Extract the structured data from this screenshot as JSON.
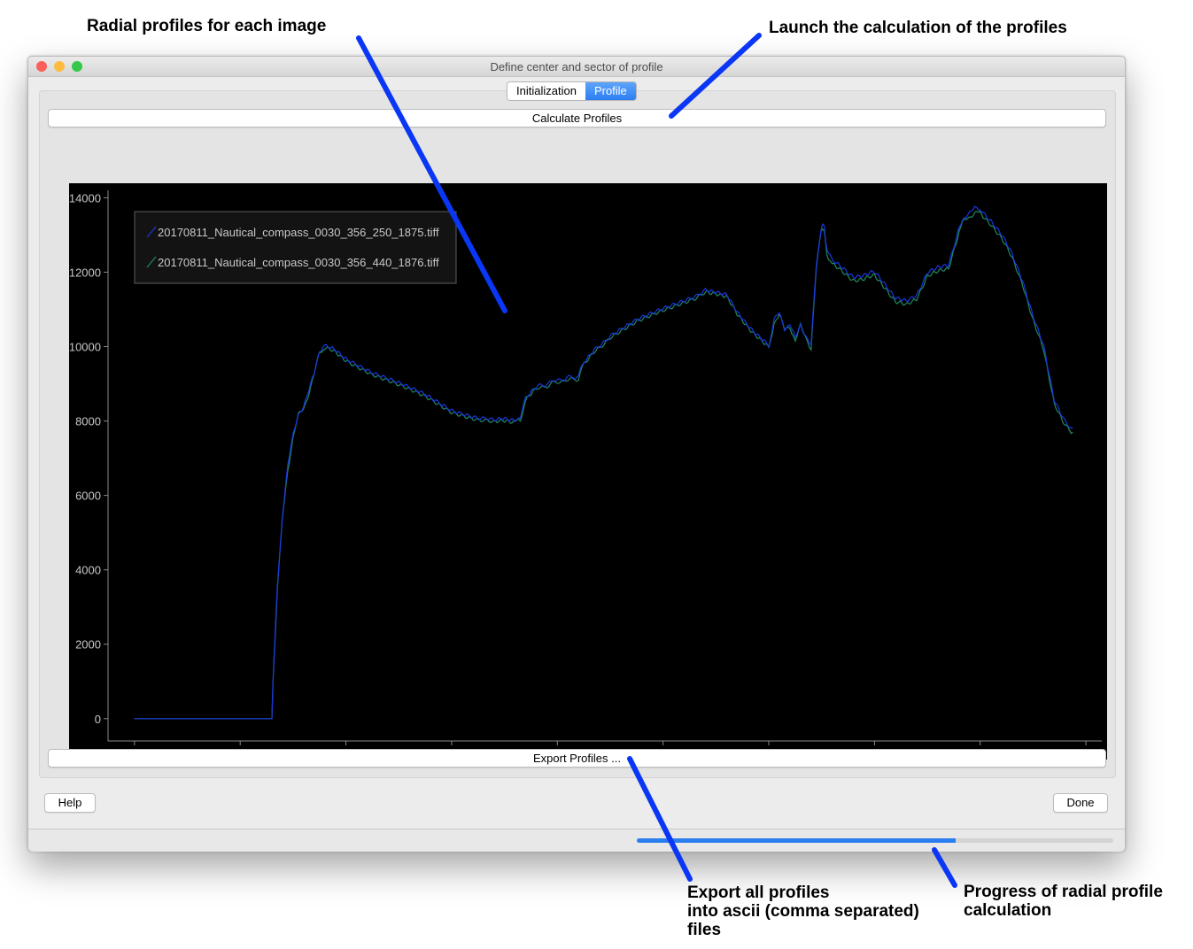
{
  "annotations": {
    "radial": "Radial profiles for each image",
    "launch": "Launch the calculation of the profiles",
    "export_line1": "Export all profiles",
    "export_line2": "into ascii (comma separated)",
    "export_line3": "files",
    "progress_line1": "Progress of radial profile",
    "progress_line2": "calculation",
    "arrow_color": "#0a36f5"
  },
  "window": {
    "title": "Define center and sector of profile",
    "traffic_lights": {
      "close": "#fc605c",
      "minimize": "#fdbc40",
      "zoom": "#34c84a"
    }
  },
  "tabs": [
    {
      "label": "Initialization",
      "active": false
    },
    {
      "label": "Profile",
      "active": true
    }
  ],
  "buttons": {
    "calculate": "Calculate Profiles",
    "export": "Export Profiles ...",
    "help": "Help",
    "done": "Done"
  },
  "progress": {
    "value": 0.67,
    "color": "#2b7ef0"
  },
  "chart_data": {
    "type": "line",
    "background": "#000000",
    "xlim": [
      -50,
      1830
    ],
    "ylim": [
      -600,
      14200
    ],
    "xticks": [
      0,
      200,
      400,
      600,
      800,
      1000,
      1200,
      1400,
      1600,
      1800
    ],
    "yticks": [
      0,
      2000,
      4000,
      6000,
      8000,
      10000,
      12000,
      14000
    ],
    "grid": false,
    "legend": "top-left",
    "series": [
      {
        "name": "20170811_Nautical_compass_0030_356_250_1875.tiff",
        "color": "#1a37e0",
        "x": [
          0,
          260,
          262,
          270,
          280,
          290,
          300,
          310,
          320,
          330,
          340,
          350,
          360,
          380,
          400,
          450,
          500,
          550,
          600,
          650,
          680,
          700,
          720,
          730,
          740,
          760,
          800,
          840,
          850,
          870,
          900,
          950,
          1000,
          1050,
          1080,
          1100,
          1120,
          1140,
          1160,
          1180,
          1200,
          1210,
          1220,
          1230,
          1240,
          1250,
          1260,
          1270,
          1280,
          1290,
          1300,
          1305,
          1310,
          1320,
          1340,
          1360,
          1380,
          1400,
          1420,
          1440,
          1460,
          1480,
          1500,
          1520,
          1540,
          1560,
          1570,
          1580,
          1590,
          1600,
          1620,
          1640,
          1660,
          1680,
          1700,
          1720,
          1740,
          1760,
          1775
        ],
        "y": [
          0,
          0,
          1000,
          3500,
          5500,
          6800,
          7600,
          8200,
          8400,
          8800,
          9300,
          9900,
          10000,
          9900,
          9700,
          9300,
          9000,
          8700,
          8300,
          8100,
          8000,
          8050,
          8050,
          8100,
          8600,
          8900,
          9100,
          9200,
          9600,
          9900,
          10300,
          10700,
          11000,
          11300,
          11500,
          11500,
          11400,
          10900,
          10600,
          10300,
          10000,
          10700,
          10900,
          10500,
          10600,
          10200,
          10600,
          10300,
          10000,
          12200,
          13300,
          13200,
          12600,
          12300,
          12100,
          11900,
          11900,
          12000,
          11700,
          11300,
          11200,
          11400,
          12000,
          12100,
          12200,
          13200,
          13500,
          13600,
          13700,
          13700,
          13400,
          13000,
          12500,
          11800,
          10800,
          10000,
          8600,
          8000,
          7800
        ]
      },
      {
        "name": "20170811_Nautical_compass_0030_356_440_1876.tiff",
        "color": "#1f8a5a",
        "x": [
          0,
          260,
          262,
          270,
          280,
          290,
          300,
          310,
          320,
          330,
          340,
          350,
          360,
          380,
          400,
          450,
          500,
          550,
          600,
          650,
          680,
          700,
          720,
          730,
          740,
          760,
          800,
          840,
          850,
          870,
          900,
          950,
          1000,
          1050,
          1080,
          1100,
          1120,
          1140,
          1160,
          1180,
          1200,
          1210,
          1220,
          1230,
          1240,
          1250,
          1260,
          1270,
          1280,
          1290,
          1300,
          1305,
          1310,
          1320,
          1340,
          1360,
          1380,
          1400,
          1420,
          1440,
          1460,
          1480,
          1500,
          1520,
          1540,
          1560,
          1570,
          1580,
          1590,
          1600,
          1620,
          1640,
          1660,
          1680,
          1700,
          1720,
          1740,
          1760,
          1775
        ],
        "y": [
          0,
          0,
          950,
          3400,
          5400,
          6700,
          7550,
          8150,
          8350,
          8750,
          9250,
          9850,
          9950,
          9850,
          9650,
          9250,
          8950,
          8650,
          8250,
          8050,
          7950,
          8000,
          8000,
          8050,
          8550,
          8850,
          9050,
          9150,
          9550,
          9850,
          10250,
          10650,
          10950,
          11250,
          11450,
          11450,
          11350,
          10850,
          10550,
          10250,
          9950,
          10650,
          10850,
          10450,
          10550,
          10150,
          10550,
          10250,
          9950,
          12100,
          13200,
          13100,
          12500,
          12200,
          12000,
          11800,
          11800,
          11900,
          11600,
          11200,
          11100,
          11300,
          11900,
          12000,
          12100,
          13100,
          13400,
          13500,
          13600,
          13600,
          13300,
          12900,
          12400,
          11700,
          10700,
          9900,
          8500,
          7900,
          7700
        ]
      }
    ]
  }
}
